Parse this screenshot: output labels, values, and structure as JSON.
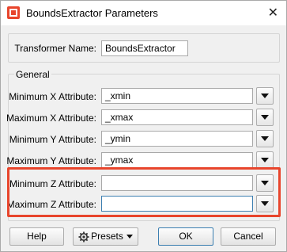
{
  "window": {
    "title": "BoundsExtractor Parameters",
    "close_glyph": "✕"
  },
  "transformer": {
    "label": "Transformer Name:",
    "value": "BoundsExtractor"
  },
  "general": {
    "group_label": "General",
    "rows": [
      {
        "label": "Minimum X Attribute:",
        "value": "_xmin"
      },
      {
        "label": "Maximum X Attribute:",
        "value": "_xmax"
      },
      {
        "label": "Minimum Y Attribute:",
        "value": "_ymin"
      },
      {
        "label": "Maximum Y Attribute:",
        "value": "_ymax"
      },
      {
        "label": "Minimum Z Attribute:",
        "value": ""
      },
      {
        "label": "Maximum Z Attribute:",
        "value": ""
      }
    ]
  },
  "buttons": {
    "help": "Help",
    "presets": "Presets",
    "ok": "OK",
    "cancel": "Cancel"
  },
  "colors": {
    "highlight": "#e8452c",
    "focus": "#3c7fb1"
  },
  "icons": {
    "app": "fme-transformer-icon",
    "presets": "gear-icon",
    "dropdown": "chevron-down-icon"
  }
}
